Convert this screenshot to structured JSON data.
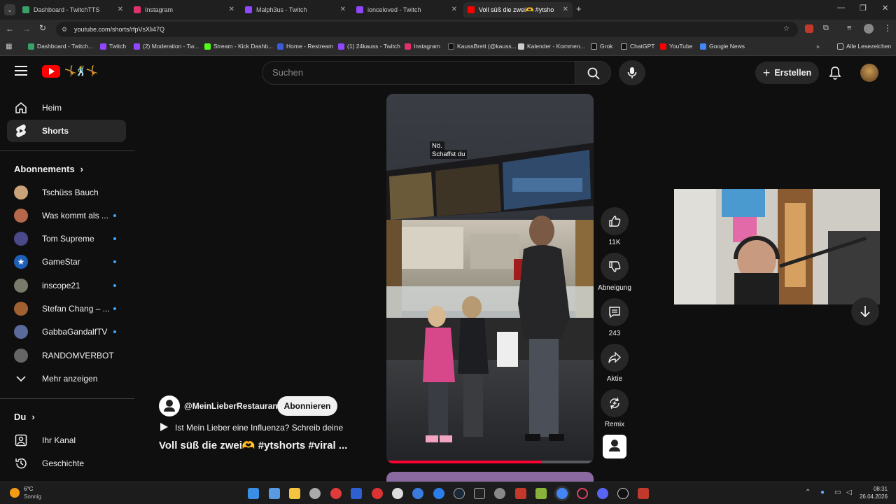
{
  "browser": {
    "tabs": [
      {
        "title": "Dashboard - TwitchTTS",
        "color": "#38a169"
      },
      {
        "title": "Instagram",
        "color": "#e1306c"
      },
      {
        "title": "Malph3us - Twitch",
        "color": "#9146ff"
      },
      {
        "title": "ionceloved - Twitch",
        "color": "#9146ff"
      },
      {
        "title": "Voll süß die zwei🫶 #ytsho",
        "color": "#ff0000"
      }
    ],
    "url": "youtube.com/shorts/rfpVsXli47Q",
    "bookmarks": [
      "Dashboard - Twitch...",
      "Twitch",
      "(2) Moderation - Tw...",
      "Stream - Kick Dashb...",
      "Home - Restream",
      "(1) 24kauss - Twitch",
      "Instagram",
      "KaussBrett (@kauss...",
      "Kalender - Kommen...",
      "Grok",
      "ChatGPT",
      "YouTube",
      "Google News"
    ],
    "all_bookmarks": "Alle Lesezeichen"
  },
  "header": {
    "search_placeholder": "Suchen",
    "create_label": "Erstellen"
  },
  "sidebar": {
    "home": "Heim",
    "shorts": "Shorts",
    "subscriptions_title": "Abonnements",
    "subscriptions": [
      {
        "name": "Tschüss Bauch",
        "color": "#c9a27a",
        "dot": false
      },
      {
        "name": "Was kommt als ...",
        "color": "#b5694a",
        "dot": true
      },
      {
        "name": "Tom Supreme",
        "color": "#4a4a8a",
        "dot": true
      },
      {
        "name": "GameStar",
        "color": "#1e5fb8",
        "dot": true
      },
      {
        "name": "inscope21",
        "color": "#7a7a6a",
        "dot": true
      },
      {
        "name": "Stefan Chang – ...",
        "color": "#a06030",
        "dot": true
      },
      {
        "name": "GabbaGandalfTV",
        "color": "#5a6a9a",
        "dot": true
      },
      {
        "name": "RANDOMVERBOT",
        "color": "#666666",
        "dot": false
      }
    ],
    "show_more": "Mehr anzeigen",
    "you_title": "Du",
    "your_channel": "Ihr Kanal",
    "history": "Geschichte"
  },
  "short": {
    "overlay_text_1": "Nö.",
    "overlay_text_2": "Schaffst du",
    "channel": "@MeinLieberRestaurant",
    "subscribe": "Abonnieren",
    "description": "Ist Mein Lieber eine Influenza? Schreib deine",
    "title": "Voll süß die zwei🫶 #ytshorts #viral ...",
    "progress": 0.75
  },
  "actions": {
    "likes": "11K",
    "dislike": "Abneigung",
    "comments": "243",
    "share": "Aktie",
    "remix": "Remix"
  },
  "taskbar": {
    "weather_temp": "6°C",
    "weather_desc": "Sonnig",
    "time": "08:31",
    "date": "26.04.2026"
  }
}
